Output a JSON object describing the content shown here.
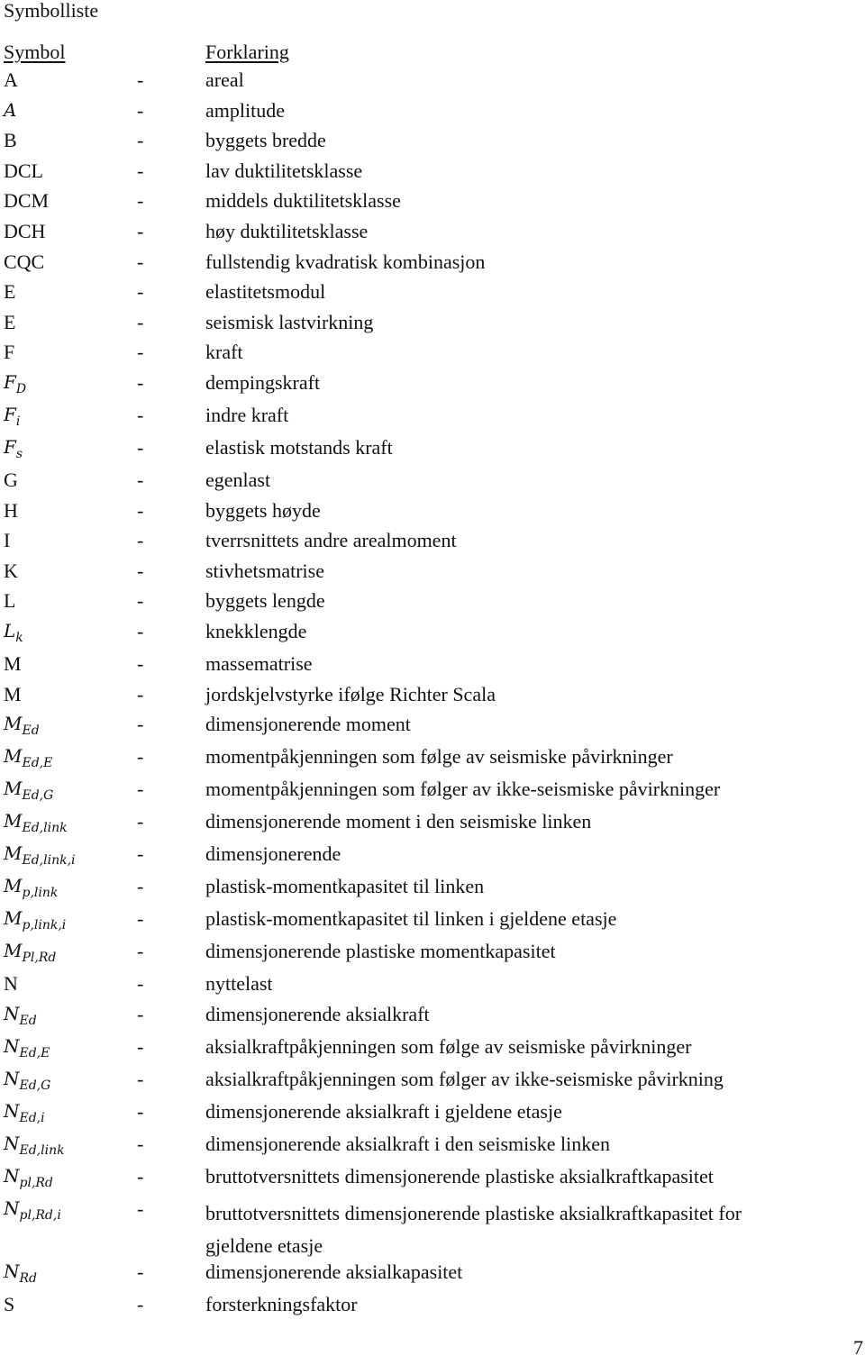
{
  "title": "Symbolliste",
  "header": {
    "symbol": "Symbol",
    "explanation": "Forklaring"
  },
  "separator": "-",
  "rows": [
    {
      "base": "A",
      "sub": "",
      "math": false,
      "desc": "areal"
    },
    {
      "base": "A",
      "sub": "",
      "math": true,
      "desc": "amplitude"
    },
    {
      "base": "B",
      "sub": "",
      "math": false,
      "desc": "byggets bredde"
    },
    {
      "base": "DCL",
      "sub": "",
      "math": false,
      "desc": "lav duktilitetsklasse"
    },
    {
      "base": "DCM",
      "sub": "",
      "math": false,
      "desc": "middels duktilitetsklasse"
    },
    {
      "base": "DCH",
      "sub": "",
      "math": false,
      "desc": "høy duktilitetsklasse"
    },
    {
      "base": "CQC",
      "sub": "",
      "math": false,
      "desc": "fullstendig kvadratisk kombinasjon"
    },
    {
      "base": "E",
      "sub": "",
      "math": false,
      "desc": "elastitetsmodul"
    },
    {
      "base": "E",
      "sub": "",
      "math": false,
      "desc": "seismisk lastvirkning"
    },
    {
      "base": "F",
      "sub": "",
      "math": false,
      "desc": "kraft"
    },
    {
      "base": "F",
      "sub": "D",
      "math": true,
      "desc": "dempingskraft"
    },
    {
      "base": "F",
      "sub": "i",
      "math": true,
      "desc": "indre kraft"
    },
    {
      "base": "F",
      "sub": "s",
      "math": true,
      "desc": "elastisk motstands kraft"
    },
    {
      "base": "G",
      "sub": "",
      "math": false,
      "desc": "egenlast"
    },
    {
      "base": "H",
      "sub": "",
      "math": false,
      "desc": "byggets høyde"
    },
    {
      "base": "I",
      "sub": "",
      "math": false,
      "desc": "tverrsnittets andre arealmoment"
    },
    {
      "base": "K",
      "sub": "",
      "math": false,
      "desc": "stivhetsmatrise"
    },
    {
      "base": "L",
      "sub": "",
      "math": false,
      "desc": "byggets lengde"
    },
    {
      "base": "L",
      "sub": "k",
      "math": true,
      "desc": "knekklengde"
    },
    {
      "base": "M",
      "sub": "",
      "math": false,
      "desc": "massematrise"
    },
    {
      "base": "M",
      "sub": "",
      "math": false,
      "desc": "jordskjelvstyrke ifølge Richter Scala"
    },
    {
      "base": "M",
      "sub": "Ed",
      "math": true,
      "desc": "dimensjonerende moment"
    },
    {
      "base": "M",
      "sub": "Ed,E",
      "math": true,
      "desc": "momentpåkjenningen som følge av seismiske påvirkninger"
    },
    {
      "base": "M",
      "sub": "Ed,G",
      "math": true,
      "desc": "momentpåkjenningen som følger av ikke-seismiske påvirkninger"
    },
    {
      "base": "M",
      "sub": "Ed,link",
      "math": true,
      "desc": "dimensjonerende moment i den seismiske linken"
    },
    {
      "base": "M",
      "sub": "Ed,link,i",
      "math": true,
      "desc": "dimensjonerende"
    },
    {
      "base": "M",
      "sub": "p,link",
      "math": true,
      "desc": "plastisk-momentkapasitet til linken"
    },
    {
      "base": "M",
      "sub": "p,link,i",
      "math": true,
      "desc": "plastisk-momentkapasitet til linken i gjeldene etasje"
    },
    {
      "base": "M",
      "sub": "Pl,Rd",
      "math": true,
      "desc": "dimensjonerende plastiske momentkapasitet"
    },
    {
      "base": "N",
      "sub": "",
      "math": false,
      "desc": "nyttelast"
    },
    {
      "base": "N",
      "sub": "Ed",
      "math": true,
      "desc": "dimensjonerende aksialkraft"
    },
    {
      "base": "N",
      "sub": "Ed,E",
      "math": true,
      "desc": "aksialkraftpåkjenningen som følge av seismiske påvirkninger"
    },
    {
      "base": "N",
      "sub": "Ed,G",
      "math": true,
      "desc": "aksialkraftpåkjenningen som følger av ikke-seismiske påvirkning"
    },
    {
      "base": "N",
      "sub": "Ed,i",
      "math": true,
      "desc": "dimensjonerende aksialkraft i gjeldene etasje"
    },
    {
      "base": "N",
      "sub": "Ed,link",
      "math": true,
      "desc": "dimensjonerende aksialkraft i den seismiske linken"
    },
    {
      "base": "N",
      "sub": "pl,Rd",
      "math": true,
      "desc": "bruttotversnittets dimensjonerende plastiske aksialkraftkapasitet"
    },
    {
      "base": "N",
      "sub": "pl,Rd,i",
      "math": true,
      "desc": "bruttotversnittets dimensjonerende plastiske aksialkraftkapasitet for",
      "desc_cont": "gjeldene etasje"
    },
    {
      "base": "N",
      "sub": "Rd",
      "math": true,
      "desc": "dimensjonerende aksialkapasitet"
    },
    {
      "base": "S",
      "sub": "",
      "math": false,
      "desc": "forsterkningsfaktor"
    }
  ],
  "page_number": "7"
}
